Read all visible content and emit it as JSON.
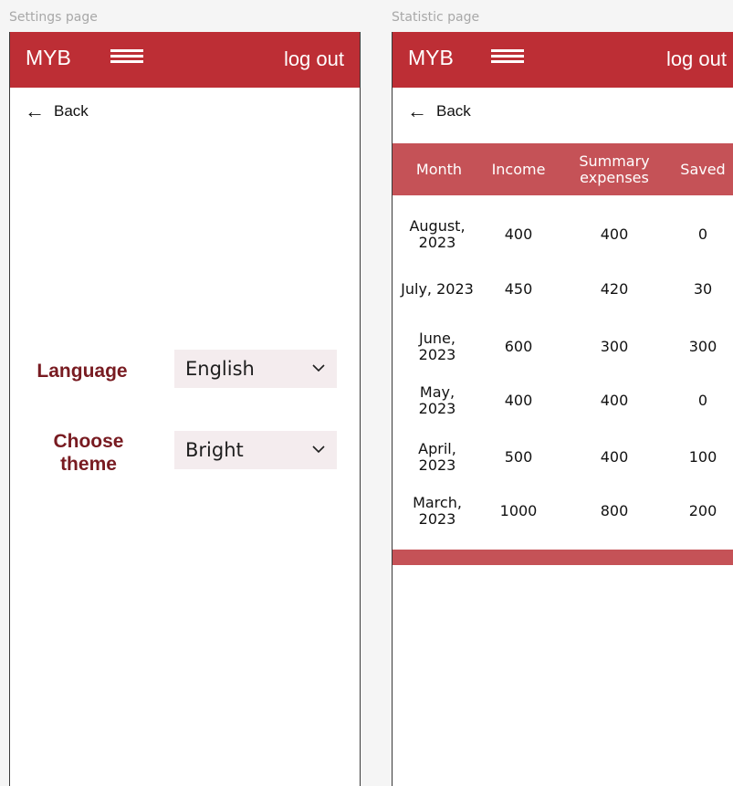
{
  "settings_page": {
    "frame_label": "Settings page",
    "header": {
      "brand": "MYB",
      "logout": "log out"
    },
    "back": {
      "arrow": "←",
      "label": "Back"
    },
    "language": {
      "label": "Language",
      "selected": "English"
    },
    "theme": {
      "label_line1": "Choose",
      "label_line2": "theme",
      "selected": "Bright"
    }
  },
  "statistic_page": {
    "frame_label": "Statistic page",
    "header": {
      "brand": "MYB",
      "logout": "log out"
    },
    "back": {
      "arrow": "←",
      "label": "Back"
    },
    "table": {
      "columns": [
        "Month",
        "Income",
        "Summary expenses",
        "Saved"
      ],
      "rows": [
        {
          "month": "August, 2023",
          "income": "400",
          "expenses": "400",
          "saved": "0"
        },
        {
          "month": "July, 2023",
          "income": "450",
          "expenses": "420",
          "saved": "30"
        },
        {
          "month": "June, 2023",
          "income": "600",
          "expenses": "300",
          "saved": "300"
        },
        {
          "month": "May, 2023",
          "income": "400",
          "expenses": "400",
          "saved": "0"
        },
        {
          "month": "April, 2023",
          "income": "500",
          "expenses": "400",
          "saved": "100"
        },
        {
          "month": "March, 2023",
          "income": "1000",
          "expenses": "800",
          "saved": "200"
        }
      ]
    }
  },
  "colors": {
    "header": "#bd2e35",
    "table_header": "#c55257",
    "label": "#781b21",
    "select_bg": "#f4ecee"
  },
  "icons": {
    "menu": "hamburger-icon",
    "back": "back-arrow-icon",
    "dropdown": "chevron-down-icon"
  }
}
